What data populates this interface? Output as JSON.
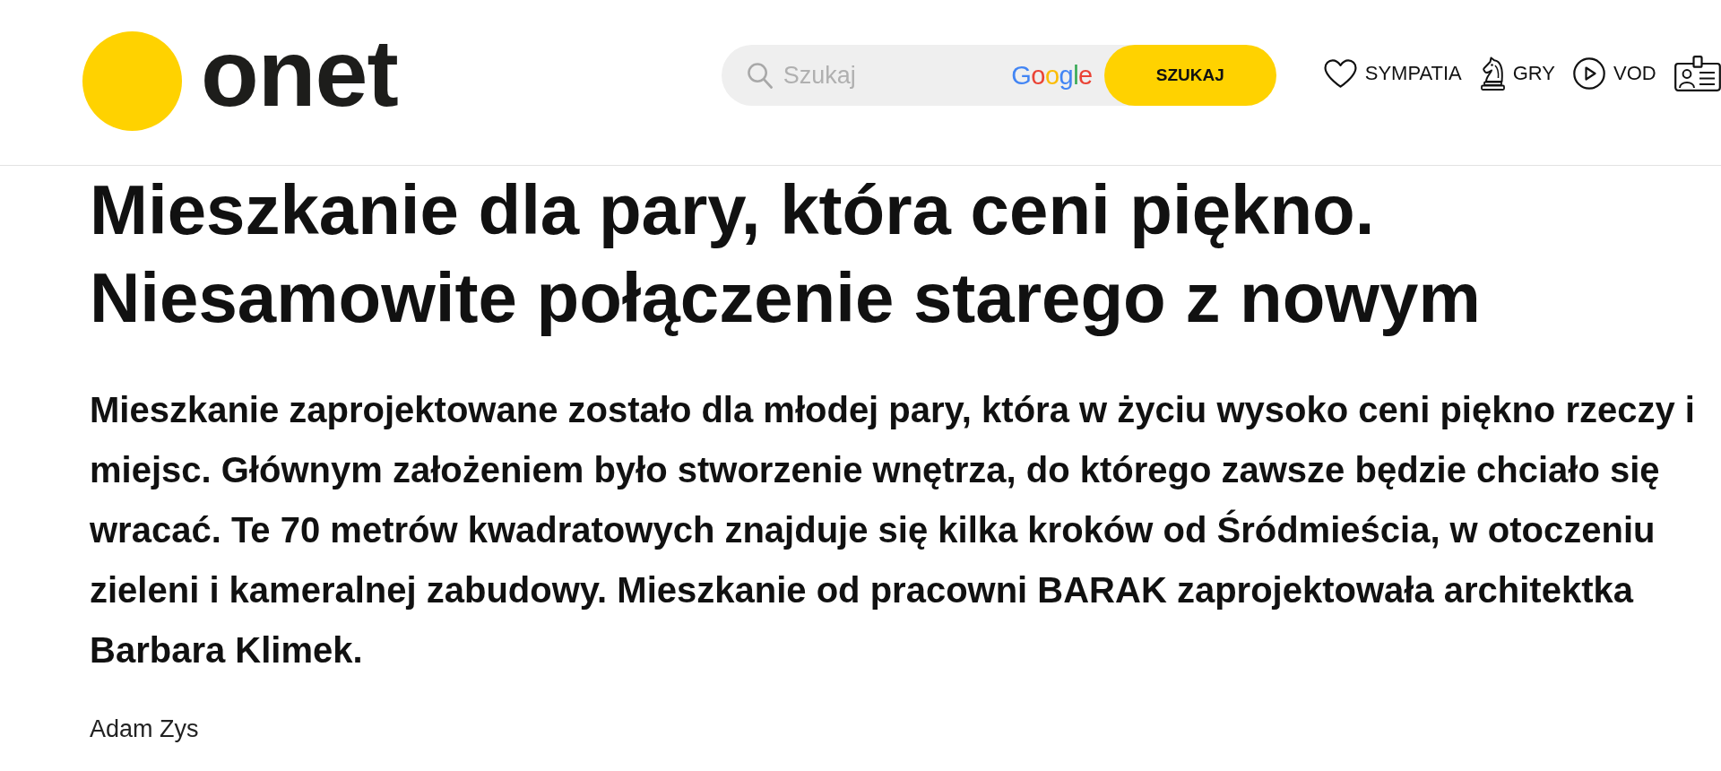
{
  "header": {
    "logo": "onet",
    "search": {
      "placeholder": "Szukaj",
      "provider": "Google",
      "button": "SZUKAJ"
    },
    "nav": [
      {
        "label": "SYMPATIA"
      },
      {
        "label": "GRY"
      },
      {
        "label": "VOD"
      }
    ]
  },
  "article": {
    "title": "Mieszkanie dla pary, która ceni piękno. Niesamowite połączenie starego z nowym",
    "lead": "Mieszkanie zaprojektowane zostało dla młodej pary, która w życiu wysoko ceni piękno rzeczy i miejsc. Głównym założeniem było stworzenie wnętrza, do którego zawsze będzie chciało się wracać. Te 70 metrów kwadratowych znajduje się kilka kroków od Śródmieścia, w otoczeniu zieleni i kameralnej zabudowy. Mieszkanie od pracowni BARAK zaprojektowała architektka Barbara Klimek.",
    "author": "Adam Zys"
  }
}
